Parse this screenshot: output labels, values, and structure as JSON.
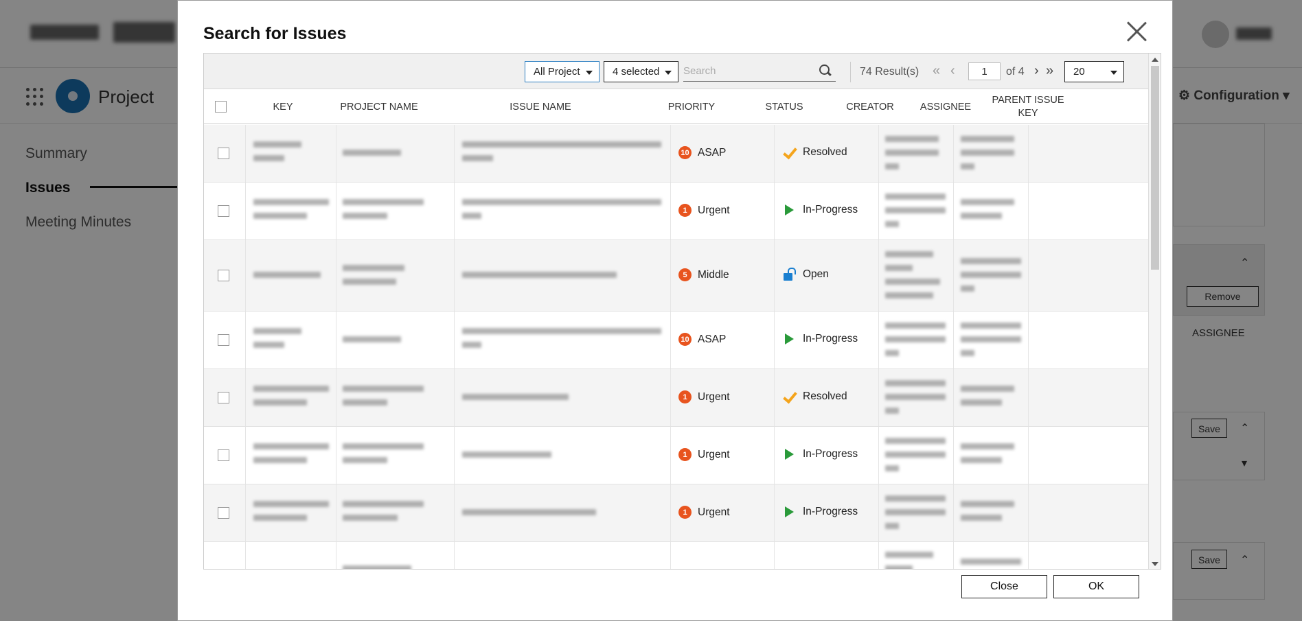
{
  "background": {
    "project_name": "Project",
    "config_label": "Configuration",
    "sidebar": [
      {
        "label": "Summary",
        "active": false
      },
      {
        "label": "Issues",
        "active": true
      },
      {
        "label": "Meeting Minutes",
        "active": false
      }
    ],
    "remove_label": "Remove",
    "assignee_label": "ASSIGNEE",
    "save_label": "Save"
  },
  "modal": {
    "title": "Search for Issues",
    "toolbar": {
      "project_filter": "All Project",
      "status_filter": "4 selected",
      "search_placeholder": "Search",
      "results": "74 Result(s)",
      "page": "1",
      "of_pages": "of 4",
      "page_size": "20"
    },
    "columns": {
      "key": "KEY",
      "project_name": "PROJECT NAME",
      "issue_name": "ISSUE NAME",
      "priority": "PRIORITY",
      "status": "STATUS",
      "creator": "CREATOR",
      "assignee": "ASSIGNEE",
      "parent_issue_key": "PARENT ISSUE KEY"
    },
    "rows": [
      {
        "priority_num": "10",
        "priority": "ASAP",
        "status": "Resolved",
        "status_icon": "check-icon"
      },
      {
        "priority_num": "1",
        "priority": "Urgent",
        "status": "In-Progress",
        "status_icon": "play-icon"
      },
      {
        "priority_num": "5",
        "priority": "Middle",
        "status": "Open",
        "status_icon": "unlock-icon"
      },
      {
        "priority_num": "10",
        "priority": "ASAP",
        "status": "In-Progress",
        "status_icon": "play-icon"
      },
      {
        "priority_num": "1",
        "priority": "Urgent",
        "status": "Resolved",
        "status_icon": "check-icon"
      },
      {
        "priority_num": "1",
        "priority": "Urgent",
        "status": "In-Progress",
        "status_icon": "play-icon"
      },
      {
        "priority_num": "1",
        "priority": "Urgent",
        "status": "In-Progress",
        "status_icon": "play-icon"
      }
    ],
    "close_label": "Close",
    "ok_label": "OK"
  },
  "colors": {
    "priority_badge": "#e8541e",
    "resolved": "#f4a41c",
    "in_progress": "#2a9a3a",
    "open": "#1a7fd0",
    "overlay": "rgba(0,0,0,0.48)"
  }
}
